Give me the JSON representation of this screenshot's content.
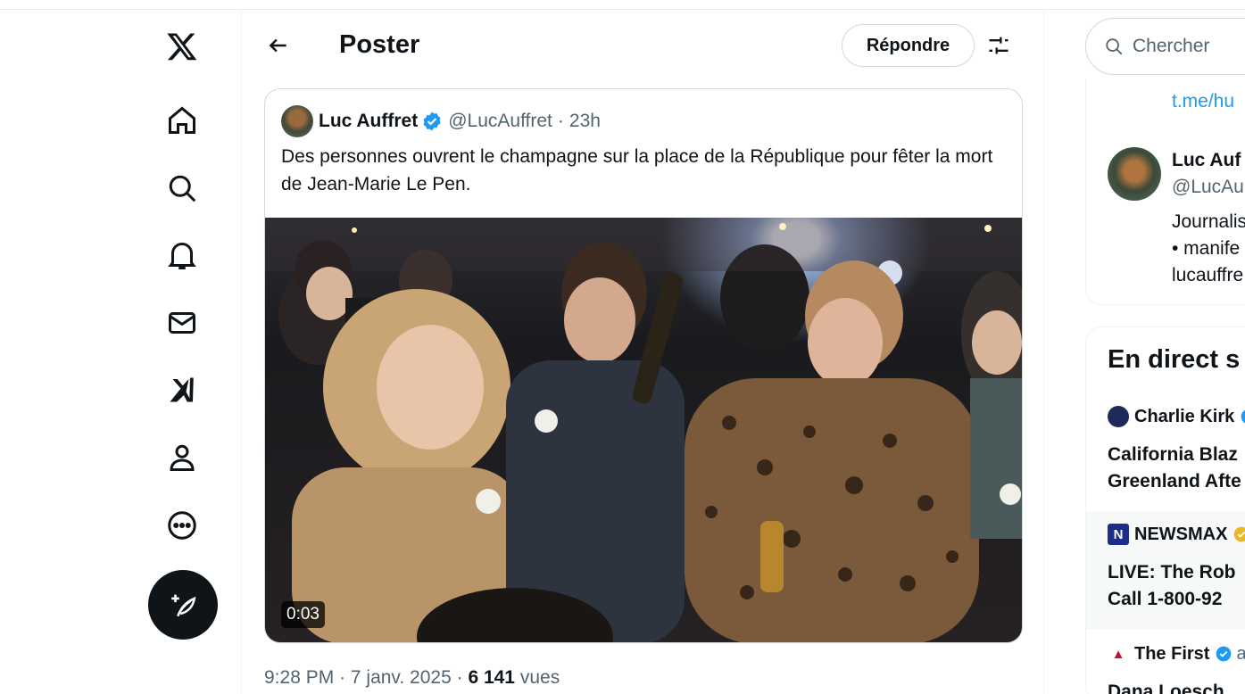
{
  "header": {
    "title": "Poster",
    "reply_label": "Répondre"
  },
  "tweet": {
    "author_name": "Luc Auffret",
    "author_handle": "@LucAuffret",
    "separator": "·",
    "time_ago": "23h",
    "text": "Des personnes ouvrent le champagne sur la place de la République pour fêter la mort de Jean-Marie Le Pen.",
    "video_duration": "0:03",
    "posted_time": "9:28 PM",
    "posted_date": "7 janv. 2025",
    "views_count": "6 141",
    "views_label": "vues"
  },
  "search": {
    "placeholder": "Chercher"
  },
  "profile_card": {
    "link": "t.me/hu",
    "name": "Luc Auf",
    "handle": "@LucAu",
    "bio_line1": "Journalis",
    "bio_line2": "• manife",
    "bio_line3": "lucauffre"
  },
  "live": {
    "title": "En direct s",
    "items": [
      {
        "account": "Charlie Kirk",
        "line1": "California Blaz",
        "line2": "Greenland Afte"
      },
      {
        "account": "NEWSMAX",
        "line1": "LIVE: The Rob",
        "line2": "Call 1-800-92"
      },
      {
        "account": "The First",
        "extra": "a",
        "line1": "Dana Loesch"
      }
    ]
  },
  "colors": {
    "accent": "#1d9bf0",
    "text": "#0f1419",
    "muted": "#536471",
    "border": "#cfd9de",
    "gold_badge": "#e8b829"
  }
}
